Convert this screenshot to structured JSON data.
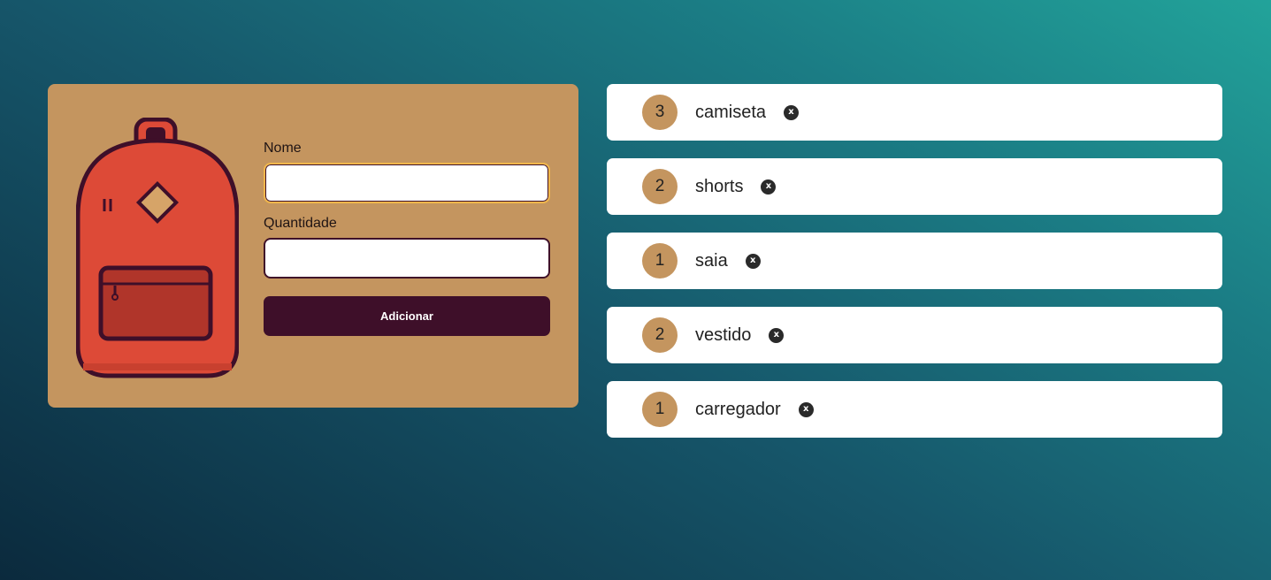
{
  "form": {
    "name_label": "Nome",
    "name_value": "",
    "quantity_label": "Quantidade",
    "quantity_value": "",
    "submit_label": "Adicionar"
  },
  "items": [
    {
      "quantity": "3",
      "name": "camiseta",
      "remove": "x"
    },
    {
      "quantity": "2",
      "name": "shorts",
      "remove": "x"
    },
    {
      "quantity": "1",
      "name": "saia",
      "remove": "x"
    },
    {
      "quantity": "2",
      "name": "vestido",
      "remove": "x"
    },
    {
      "quantity": "1",
      "name": "carregador",
      "remove": "x"
    }
  ],
  "colors": {
    "card": "#c4955f",
    "button": "#3e0f29",
    "focus_ring": "#f0b64b",
    "badge": "#c4955f",
    "backpack_body": "#dd4a37",
    "backpack_outline": "#3e0f29"
  },
  "icons": {
    "illustration": "backpack-icon",
    "remove": "close-icon"
  }
}
